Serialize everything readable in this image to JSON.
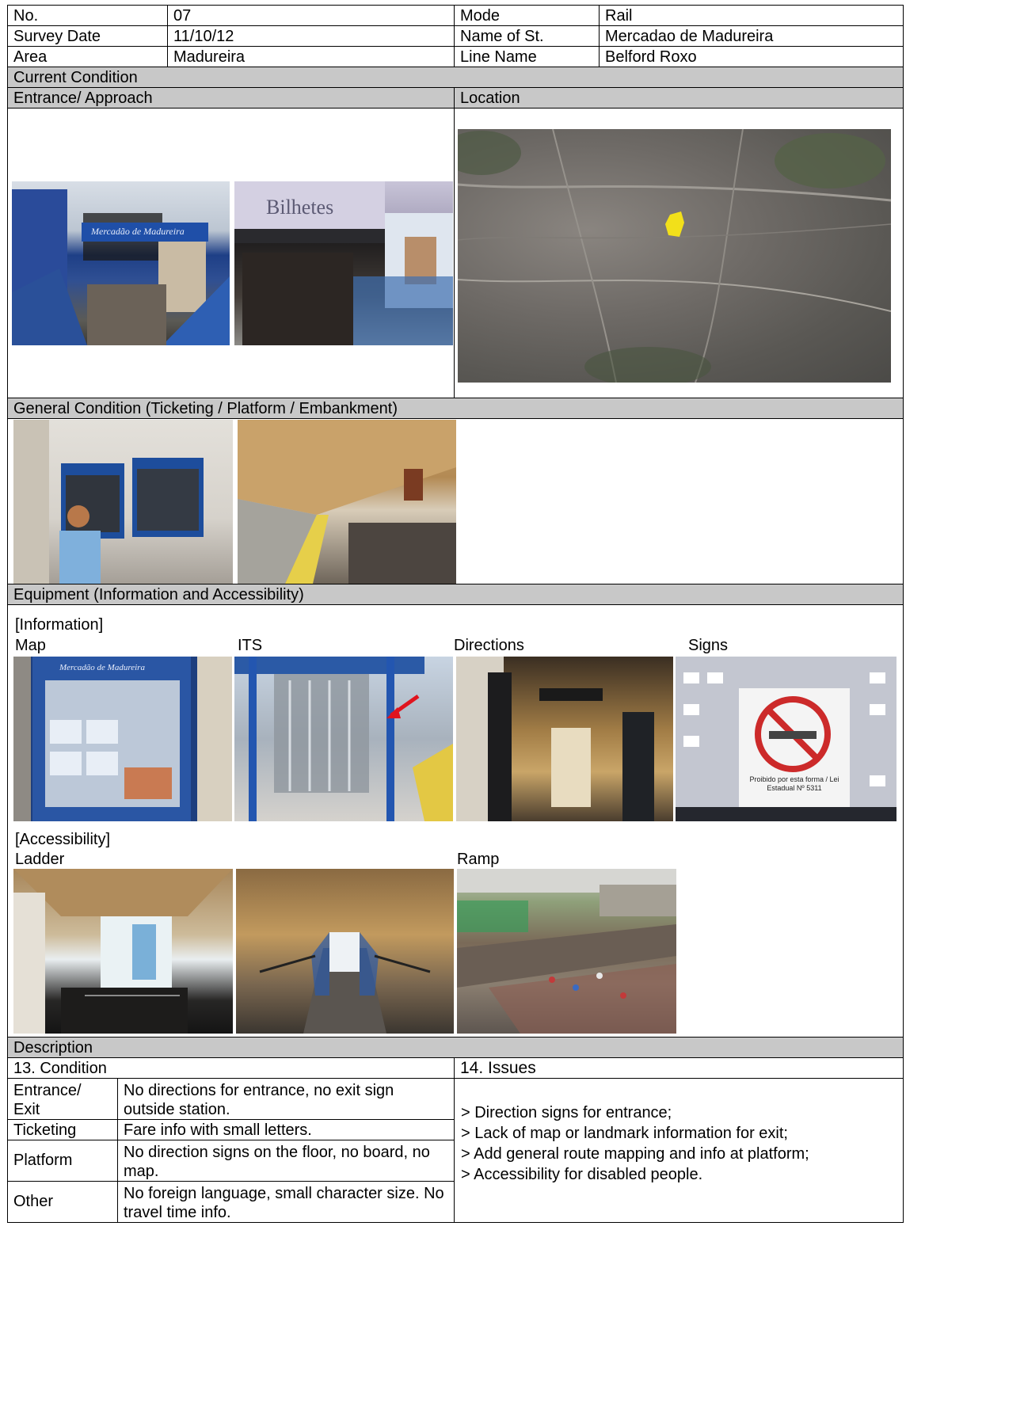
{
  "header": {
    "no_label": "No.",
    "no_value": "07",
    "mode_label": "Mode",
    "mode_value": "Rail",
    "date_label": "Survey Date",
    "date_value": "11/10/12",
    "station_label": "Name of St.",
    "station_value": "Mercadao de Madureira",
    "area_label": "Area",
    "area_value": "Madureira",
    "line_label": "Line Name",
    "line_value": "Belford Roxo"
  },
  "sections": {
    "current": "Current Condition",
    "entrance": "Entrance/ Approach",
    "location": "Location",
    "general": "General Condition (Ticketing / Platform / Embankment)",
    "equipment": "Equipment (Information and Accessibility)",
    "information": "[Information]",
    "accessibility": "[Accessibility]",
    "description": "Description"
  },
  "info_labels": {
    "map": "Map",
    "its": "ITS",
    "directions": "Directions",
    "signs": "Signs"
  },
  "access_labels": {
    "ladder": "Ladder",
    "ramp": "Ramp"
  },
  "photo_text": {
    "entrance_sign": "Mercadão de Madureira",
    "entrance_brand": "Bilhetes",
    "map_poster": "Mercadão de Madureira",
    "no_smoking": "Proibido por esta forma / Lei Estadual Nº 5311"
  },
  "condition": {
    "title": "13. Condition",
    "rows": [
      {
        "label": "Entrance/ Exit",
        "text": "No directions for entrance, no exit sign outside station."
      },
      {
        "label": "Ticketing",
        "text": "Fare info with small letters."
      },
      {
        "label": "Platform",
        "text": "No direction signs on the floor, no board, no map."
      },
      {
        "label": "Other",
        "text": "No foreign language, small character size. No travel time info."
      }
    ]
  },
  "issues": {
    "title": "14. Issues",
    "items": [
      "> Direction signs for entrance;",
      "> Lack of map or landmark information for exit;",
      "> Add general route mapping and info at platform;",
      "> Accessibility for disabled people."
    ]
  },
  "colors": {
    "header_gray": "#c8c8c8",
    "sign_blue": "#1f4fa8",
    "marker_yellow": "#f2e01a",
    "arrow_red": "#e0141e"
  }
}
